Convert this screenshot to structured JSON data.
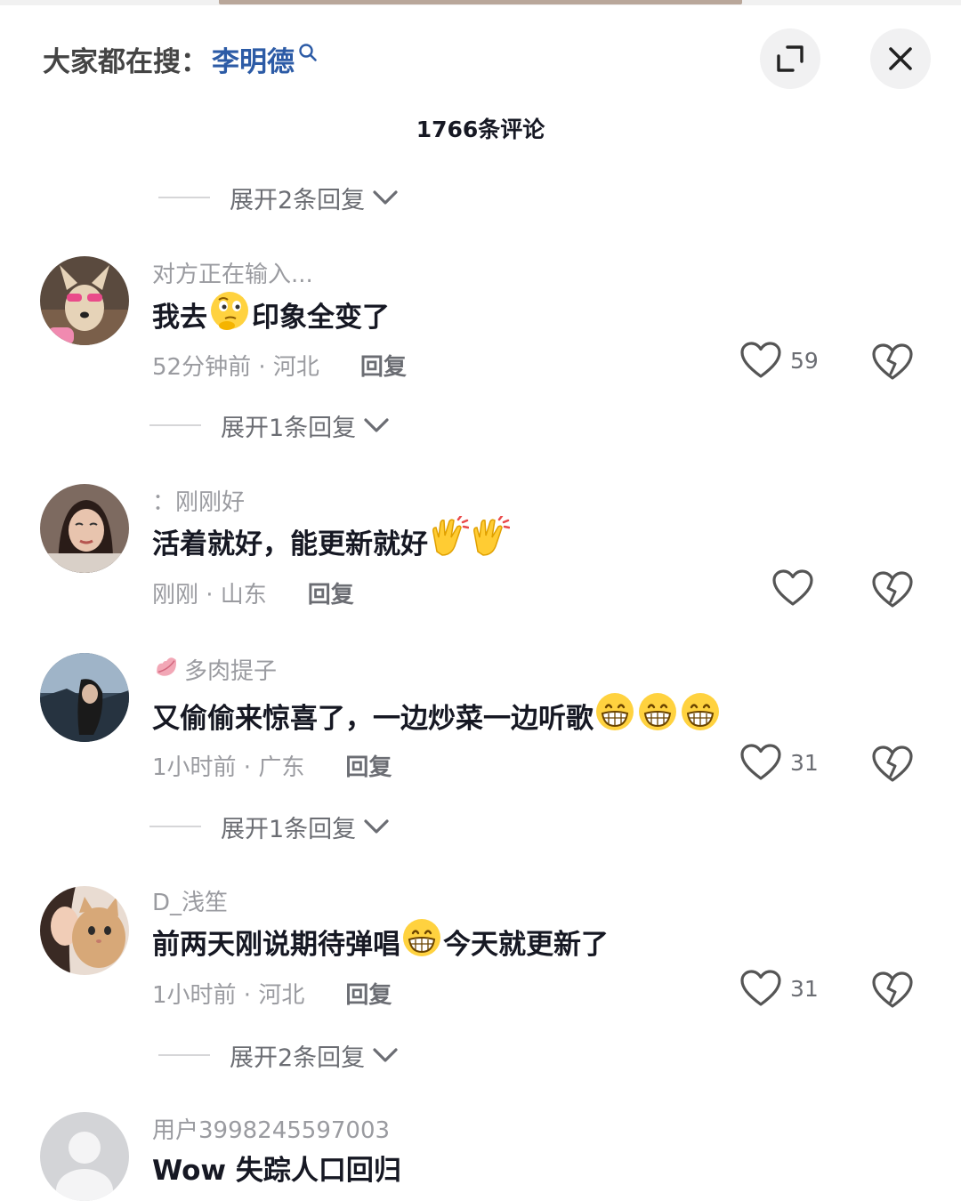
{
  "header": {
    "trend_prefix": "大家都在搜：",
    "trend_keyword": "李明德"
  },
  "comment_count": "1766条评论",
  "expand_rows": {
    "r0": "展开2条回复",
    "r1": "展开1条回复",
    "r2": "展开1条回复",
    "r3": "展开2条回复"
  },
  "comments": [
    {
      "username": "对方正在输入...",
      "text_before": "我去",
      "emoji": "thinking-emoji",
      "text_after": "印象全变了",
      "time_location": "52分钟前 · 河北",
      "reply_label": "回复",
      "likes": "59"
    },
    {
      "username": "：刚刚好",
      "text_before": "活着就好，能更新就好",
      "emoji": "clapping-hands-emoji",
      "time_location": "刚刚 · 山东",
      "reply_label": "回复",
      "likes": ""
    },
    {
      "username": "多肉提子",
      "username_icon": "lips-icon",
      "text_before": "又偷偷来惊喜了，一边炒菜一边听歌",
      "emoji": "grinning-face-emoji",
      "time_location": "1小时前 · 广东",
      "reply_label": "回复",
      "likes": "31"
    },
    {
      "username": "D_浅笙",
      "text_before": "前两天刚说期待弹唱",
      "emoji": "grinning-face-emoji",
      "text_after": "今天就更新了",
      "time_location": "1小时前 · 河北",
      "reply_label": "回复",
      "likes": "31"
    },
    {
      "username": "用户3998245597003",
      "text_before": "Wow 失踪人口回归"
    }
  ],
  "colors": {
    "keyword": "#2c5ba6",
    "text_primary": "#161823",
    "text_secondary": "#9a9ba0",
    "reply": "#6b6d73",
    "button_bg": "#f1f1f2"
  }
}
